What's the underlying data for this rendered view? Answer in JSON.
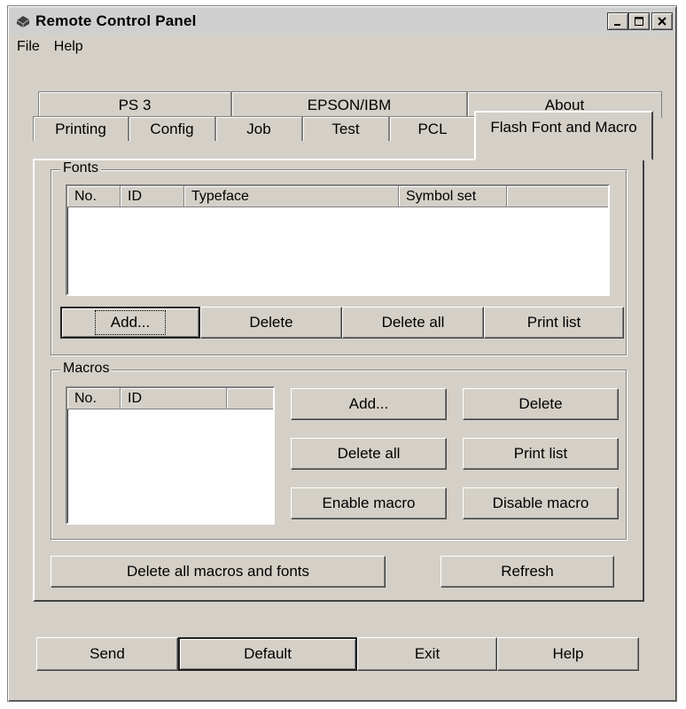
{
  "window": {
    "title": "Remote Control Panel"
  },
  "menu": [
    "File",
    "Help"
  ],
  "tabs_back": [
    "PS 3",
    "EPSON/IBM",
    "About"
  ],
  "tabs_front": [
    "Printing",
    "Config",
    "Job",
    "Test",
    "PCL",
    "Flash Font and Macro"
  ],
  "fonts": {
    "label": "Fonts",
    "columns": [
      "No.",
      "ID",
      "Typeface",
      "Symbol set"
    ],
    "buttons": {
      "add": "Add...",
      "delete": "Delete",
      "delete_all": "Delete all",
      "print_list": "Print list"
    }
  },
  "macros": {
    "label": "Macros",
    "columns": [
      "No.",
      "ID"
    ],
    "buttons": {
      "add": "Add...",
      "delete": "Delete",
      "delete_all": "Delete all",
      "print_list": "Print list",
      "enable": "Enable macro",
      "disable": "Disable macro"
    }
  },
  "panel_buttons": {
    "delete_all_macros_fonts": "Delete all macros and fonts",
    "refresh": "Refresh"
  },
  "footer_buttons": {
    "send": "Send",
    "default": "Default",
    "exit": "Exit",
    "help": "Help"
  }
}
